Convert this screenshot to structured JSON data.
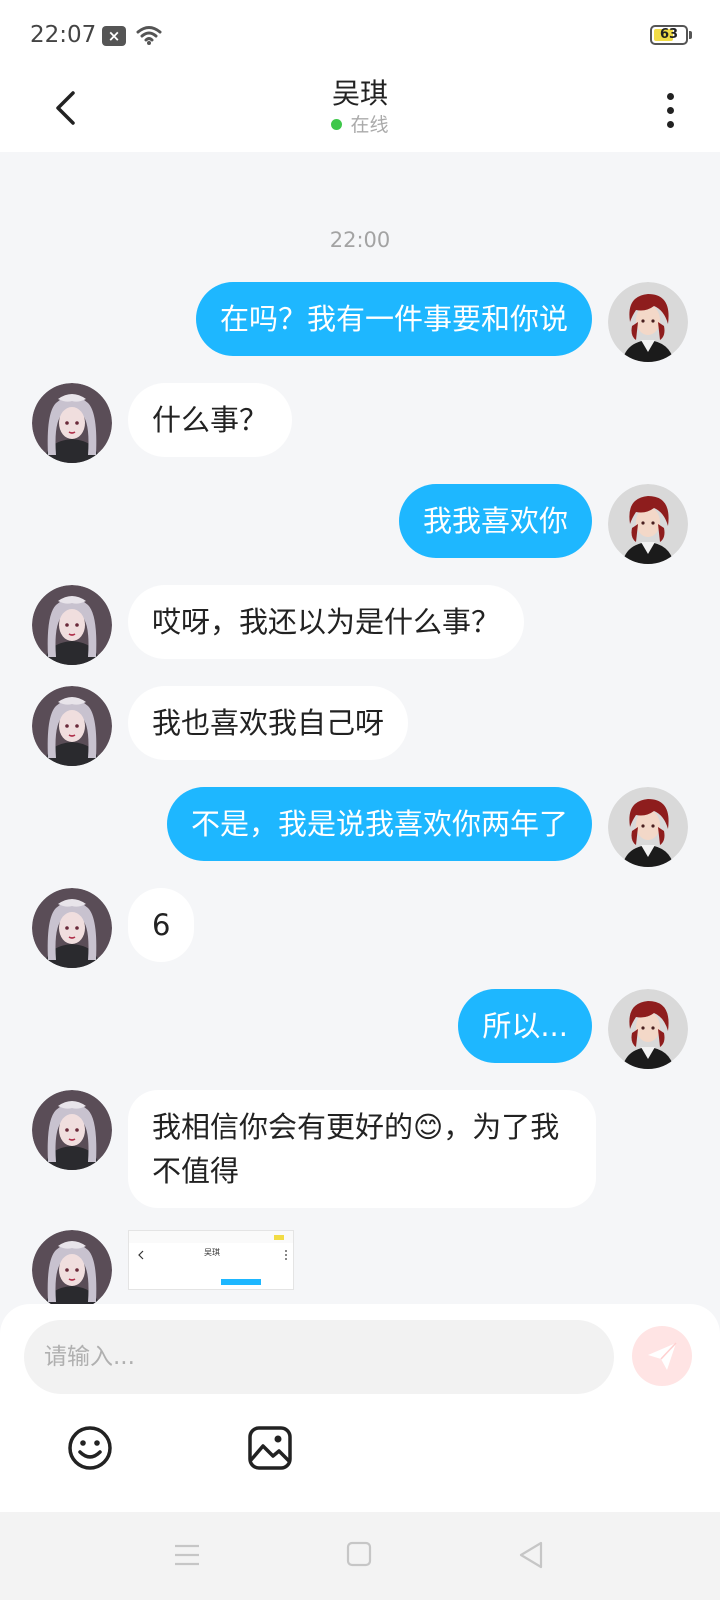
{
  "status_bar": {
    "time": "22:07",
    "battery_level": "63",
    "battery_fraction": 0.63
  },
  "header": {
    "title": "吴琪",
    "status": "在线",
    "status_color": "#3ec74a"
  },
  "chat": {
    "timestamp": "22:00",
    "messages": [
      {
        "from": "me",
        "text": "在吗？我有一件事要和你说"
      },
      {
        "from": "her",
        "text": "什么事？"
      },
      {
        "from": "me",
        "text": "我我喜欢你"
      },
      {
        "from": "her",
        "text": "哎呀，我还以为是什么事？"
      },
      {
        "from": "her",
        "text": "我也喜欢我自己呀"
      },
      {
        "from": "me",
        "text": "不是，我是说我喜欢你两年了"
      },
      {
        "from": "her",
        "text": "6"
      },
      {
        "from": "me",
        "text": "所以..."
      },
      {
        "from": "her",
        "text": "我相信你会有更好的😊，为了我不值得"
      }
    ],
    "image_message_title": "吴琪"
  },
  "input": {
    "placeholder": "请输入..."
  },
  "colors": {
    "outgoing_bubble": "#1eb7ff",
    "incoming_bubble": "#ffffff",
    "background": "#f5f6f8",
    "send_button": "#ffe4e4"
  },
  "icons": {
    "back": "chevron-left-icon",
    "more": "more-vertical-icon",
    "send": "paper-plane-icon",
    "emoji": "smiley-icon",
    "image": "image-icon"
  }
}
